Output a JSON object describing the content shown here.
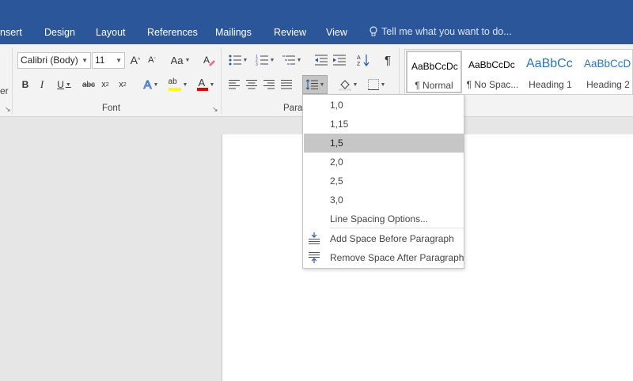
{
  "tabs": [
    "nsert",
    "Design",
    "Layout",
    "References",
    "Mailings",
    "Review",
    "View"
  ],
  "tell_me": "Tell me what you want to do...",
  "font": {
    "name": "Calibri (Body)",
    "size": "11",
    "group_label": "Font"
  },
  "paragraph": {
    "group_label": "Parag"
  },
  "left_partial_label": "er",
  "styles": [
    {
      "sample": "AaBbCcDc",
      "name": "¶ Normal"
    },
    {
      "sample": "AaBbCcDc",
      "name": "¶ No Spac..."
    },
    {
      "sample": "AaBbCc",
      "name": "Heading 1"
    },
    {
      "sample": "AaBbCcD",
      "name": "Heading 2"
    }
  ],
  "line_spacing_menu": {
    "options": [
      "1,0",
      "1,15",
      "1,5",
      "2,0",
      "2,5",
      "3,0"
    ],
    "selected": "1,5",
    "options_link": "Line Spacing Options...",
    "add_before": "Add Space Before Paragraph",
    "remove_after": "Remove Space After Paragraph"
  },
  "colors": {
    "ribbon_blue": "#2b579a",
    "highlight_yellow": "#ffff00",
    "font_red": "#e00000",
    "heading_blue": "#2e74b5"
  }
}
